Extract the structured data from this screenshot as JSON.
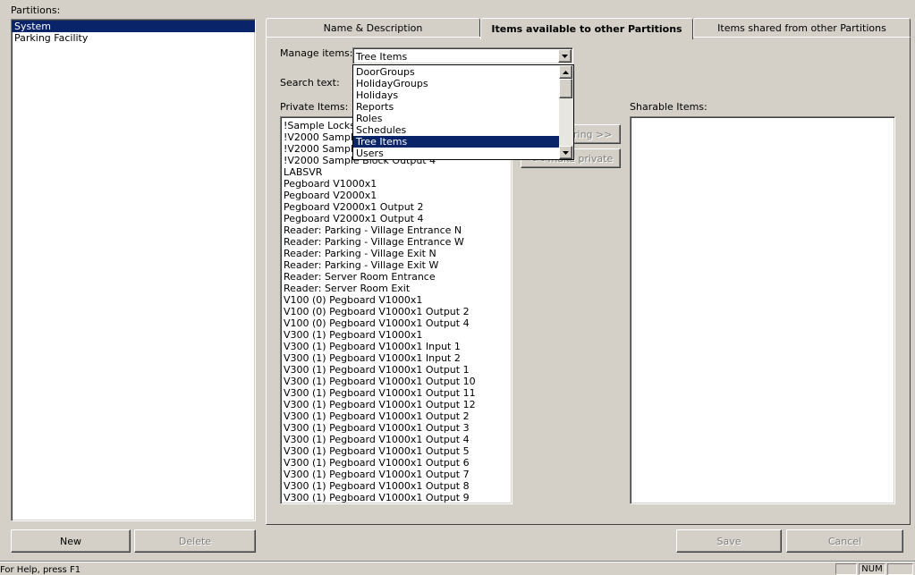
{
  "partitions": {
    "label": "Partitions:",
    "items": [
      {
        "label": "System",
        "selected": true
      },
      {
        "label": "Parking Facility",
        "selected": false
      }
    ],
    "new_label": "New",
    "delete_label": "Delete"
  },
  "tabs": [
    {
      "label": "Name & Description",
      "active": false
    },
    {
      "label": "Items available to other Partitions",
      "active": true
    },
    {
      "label": "Items shared from other Partitions",
      "active": false
    }
  ],
  "manage": {
    "label": "Manage items:",
    "selected": "Tree Items",
    "options": [
      {
        "label": "DoorGroups",
        "selected": false
      },
      {
        "label": "HolidayGroups",
        "selected": false
      },
      {
        "label": "Holidays",
        "selected": false
      },
      {
        "label": "Reports",
        "selected": false
      },
      {
        "label": "Roles",
        "selected": false
      },
      {
        "label": "Schedules",
        "selected": false
      },
      {
        "label": "Tree Items",
        "selected": true
      },
      {
        "label": "Users",
        "selected": false
      }
    ]
  },
  "search": {
    "label": "Search text:",
    "value": ""
  },
  "private": {
    "label": "Private Items:",
    "items": [
      "!Sample Lockset",
      "!V2000 Sample",
      "!V2000 Sample",
      "!V2000 Sample Block Output 4",
      "LABSVR",
      "Pegboard V1000x1",
      "Pegboard V2000x1",
      "Pegboard V2000x1 Output 2",
      "Pegboard V2000x1 Output 4",
      "Reader: Parking - Village Entrance N",
      "Reader: Parking - Village Entrance W",
      "Reader: Parking - Village Exit N",
      "Reader: Parking - Village Exit W",
      "Reader: Server Room Entrance",
      "Reader: Server Room Exit",
      "V100 (0) Pegboard V1000x1",
      "V100 (0) Pegboard V1000x1 Output 2",
      "V100 (0) Pegboard V1000x1 Output 4",
      "V300 (1) Pegboard V1000x1",
      "V300 (1) Pegboard V1000x1 Input 1",
      "V300 (1) Pegboard V1000x1 Input 2",
      "V300 (1) Pegboard V1000x1 Output 1",
      "V300 (1) Pegboard V1000x1 Output 10",
      "V300 (1) Pegboard V1000x1 Output 11",
      "V300 (1) Pegboard V1000x1 Output 12",
      "V300 (1) Pegboard V1000x1 Output 2",
      "V300 (1) Pegboard V1000x1 Output 3",
      "V300 (1) Pegboard V1000x1 Output 4",
      "V300 (1) Pegboard V1000x1 Output 5",
      "V300 (1) Pegboard V1000x1 Output 6",
      "V300 (1) Pegboard V1000x1 Output 7",
      "V300 (1) Pegboard V1000x1 Output 8",
      "V300 (1) Pegboard V1000x1 Output 9"
    ]
  },
  "sharable": {
    "label": "Sharable Items:"
  },
  "actions": {
    "share_label": "sharing >>",
    "private_label": "<< make private"
  },
  "bottom": {
    "save_label": "Save",
    "cancel_label": "Cancel"
  },
  "status": {
    "help": "For Help, press F1",
    "num": "NUM"
  },
  "colors": {
    "face": "#d4d0c8",
    "selection": "#0a246a"
  }
}
